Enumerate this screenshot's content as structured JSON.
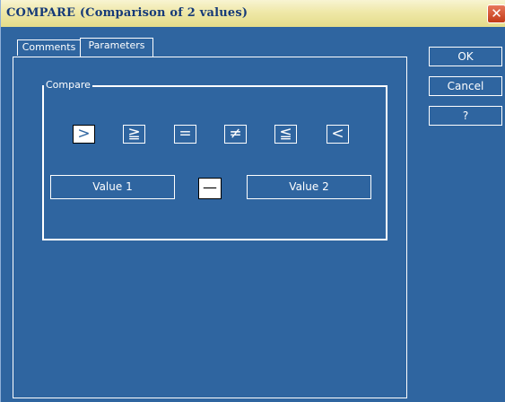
{
  "window": {
    "title": "COMPARE (Comparison of 2 values)",
    "close_glyph": "✕"
  },
  "tabs": [
    {
      "label": "Comments",
      "active": false
    },
    {
      "label": "Parameters",
      "active": true
    }
  ],
  "compare_group": {
    "label": "Compare",
    "operators": [
      {
        "name": "greater-than",
        "glyph": ">",
        "selected": true
      },
      {
        "name": "greater-or-equal",
        "glyph": "≧",
        "selected": false
      },
      {
        "name": "equal",
        "glyph": "=",
        "selected": false
      },
      {
        "name": "not-equal",
        "glyph": "≠",
        "selected": false
      },
      {
        "name": "less-or-equal",
        "glyph": "≦",
        "selected": false
      },
      {
        "name": "less-than",
        "glyph": "<",
        "selected": false
      }
    ],
    "value1_label": "Value 1",
    "value2_label": "Value 2",
    "current_operator_glyph": "—"
  },
  "buttons": {
    "ok": "OK",
    "cancel": "Cancel",
    "help": "?"
  },
  "colors": {
    "background": "#2f65a0",
    "title_bar": "#efe8a8",
    "title_text": "#163a78",
    "close_button": "#d4532f",
    "outline": "#ffffff"
  }
}
